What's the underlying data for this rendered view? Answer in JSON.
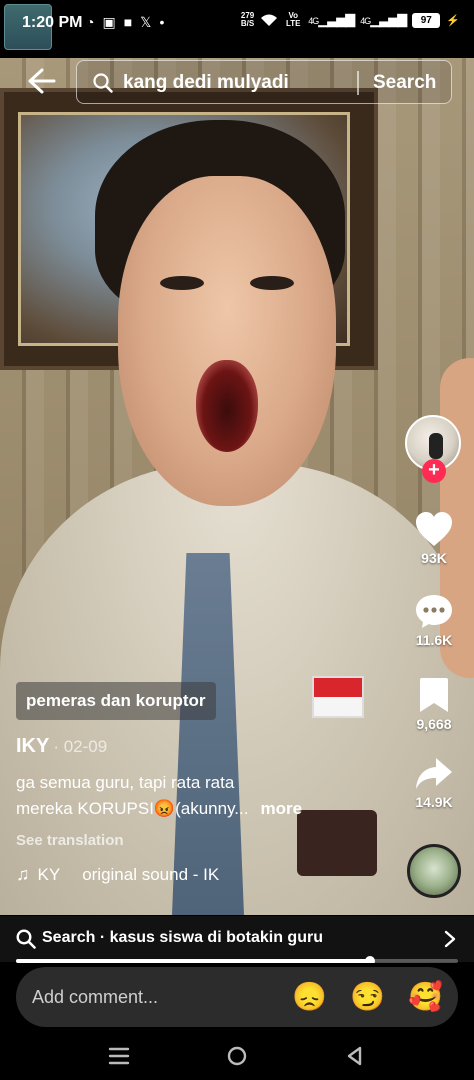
{
  "status_bar": {
    "time": "1:20 PM",
    "left_icons": [
      "whatsapp-icon",
      "notification-icon",
      "app-icon",
      "x-icon",
      "dot-icon"
    ],
    "net_speed_value": "279",
    "net_speed_unit": "B/S",
    "volte": "Vo LTE",
    "signal_1": "4G",
    "signal_2": "4G",
    "battery": "97"
  },
  "header": {
    "search_query": "kang dedi mulyadi",
    "search_button": "Search"
  },
  "actions": {
    "likes": "93K",
    "comments": "11.6K",
    "bookmarks": "9,668",
    "shares": "14.9K",
    "follow_symbol": "+"
  },
  "post": {
    "tag": "pemeras dan koruptor",
    "author": "IKY",
    "date": "· 02-09",
    "caption_line1": "ga semua guru, tapi rata rata",
    "caption_line2": "mereka KORUPSI😡(akunny...",
    "more": "more",
    "see_translation": "See translation",
    "sound_author": "KY",
    "sound_title": "original sound - IK"
  },
  "related_search": {
    "label": "Search · kasus siswa di botakin guru"
  },
  "progress": {
    "fraction": 0.8
  },
  "comment_bar": {
    "placeholder": "Add comment...",
    "emojis": [
      "😞",
      "😏",
      "🥰"
    ]
  },
  "colors": {
    "accent": "#fe2c55",
    "background": "#000000",
    "comment_pill": "#2c2c2c"
  }
}
